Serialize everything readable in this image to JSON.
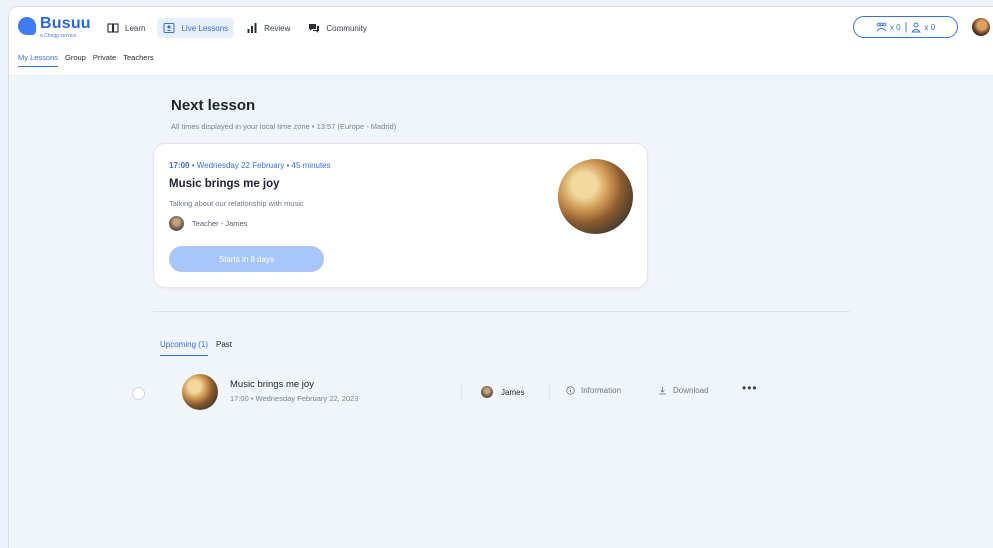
{
  "app": {
    "brand": "Busuu",
    "brand_sub": "a Chegg service"
  },
  "nav": {
    "items": [
      {
        "label": "Learn",
        "icon": "book-icon"
      },
      {
        "label": "Live Lessons",
        "icon": "live-lessons-icon",
        "active": true
      },
      {
        "label": "Review",
        "icon": "bar-chart-icon"
      },
      {
        "label": "Community",
        "icon": "community-icon"
      }
    ]
  },
  "subnav": {
    "items": [
      {
        "label": "My Lessons",
        "active": true
      },
      {
        "label": "Group"
      },
      {
        "label": "Private"
      },
      {
        "label": "Teachers"
      }
    ]
  },
  "counters": {
    "group": "x 0",
    "private": "x 0",
    "separator": "|"
  },
  "next_lesson": {
    "heading": "Next lesson",
    "timezone_note": "All times displayed in your local time zone • 13:57 (Europe - Madrid)",
    "time": "17:00",
    "date": "Wednesday 22 February",
    "duration": "45 minutes",
    "dot": "•",
    "title": "Music brings me joy",
    "description": "Talking about our relationship with music",
    "teacher": "Teacher - James",
    "button": "Starts in 8 days"
  },
  "tabs": [
    {
      "label": "Upcoming (1)",
      "active": true
    },
    {
      "label": "Past"
    }
  ],
  "lessons": [
    {
      "title": "Music brings me joy",
      "subtitle": "17:00 • Wednesday February 22, 2023",
      "teacher": "James",
      "info_label": "Information",
      "download_label": "Download",
      "more": "•••"
    }
  ],
  "colors": {
    "accent": "#3570ee",
    "button_disabled": "#a8c6fb",
    "background": "#f1f5fc"
  }
}
